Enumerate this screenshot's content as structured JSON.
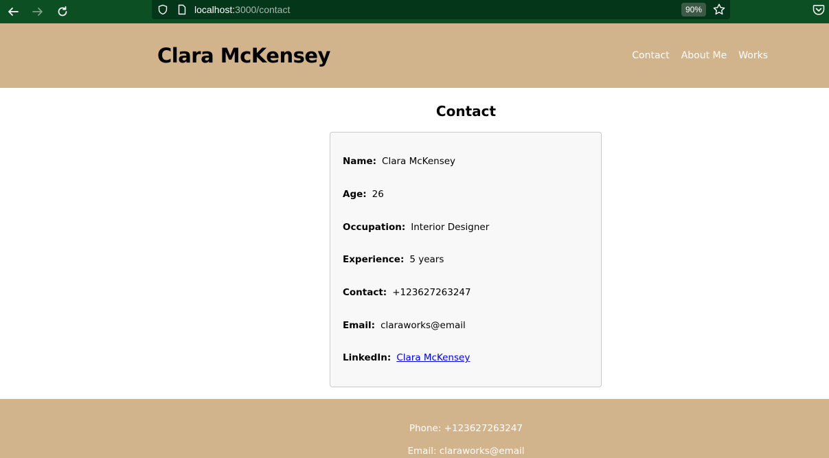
{
  "browser": {
    "url_host": "localhost:",
    "url_rest": "3000/contact",
    "zoom": "90%",
    "icons": [
      "back-arrow-icon",
      "forward-arrow-icon",
      "reload-icon",
      "shield-icon",
      "page-icon",
      "star-icon",
      "pocket-icon"
    ]
  },
  "header": {
    "title": "Clara McKensey",
    "nav": [
      "Contact",
      "About Me",
      "Works"
    ]
  },
  "main": {
    "heading": "Contact",
    "rows": [
      {
        "label": "Name:",
        "value": "Clara McKensey"
      },
      {
        "label": "Age:",
        "value": "26"
      },
      {
        "label": "Occupation:",
        "value": "Interior Designer"
      },
      {
        "label": "Experience:",
        "value": "5 years"
      },
      {
        "label": "Contact:",
        "value": "+123627263247"
      },
      {
        "label": "Email:",
        "value": "claraworks@email"
      },
      {
        "label": "LinkedIn:",
        "value": "Clara McKensey"
      }
    ]
  },
  "footer": {
    "phone": "Phone: +123627263247",
    "email": "Email: claraworks@email"
  },
  "colors": {
    "browser_bar": "#0b4f22",
    "accent_tan": "#d2b48c",
    "link_blue": "#0000ee"
  }
}
